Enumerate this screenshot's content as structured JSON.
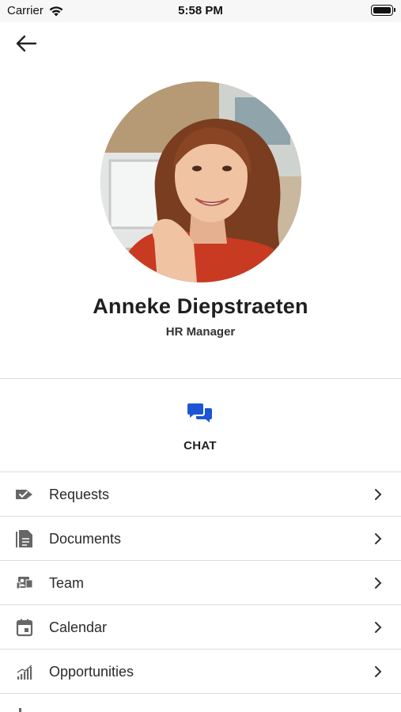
{
  "status_bar": {
    "carrier": "Carrier",
    "time": "5:58 PM"
  },
  "profile": {
    "name": "Anneke Diepstraeten",
    "role": "HR Manager"
  },
  "actions": {
    "chat_label": "CHAT",
    "chat_icon": "chat-bubbles-icon",
    "accent_color": "#1a56d6"
  },
  "menu": {
    "items": [
      {
        "label": "Requests",
        "icon": "requests-arrow-icon"
      },
      {
        "label": "Documents",
        "icon": "document-icon"
      },
      {
        "label": "Team",
        "icon": "team-icon"
      },
      {
        "label": "Calendar",
        "icon": "calendar-icon"
      },
      {
        "label": "Opportunities",
        "icon": "chart-bars-icon"
      }
    ]
  }
}
